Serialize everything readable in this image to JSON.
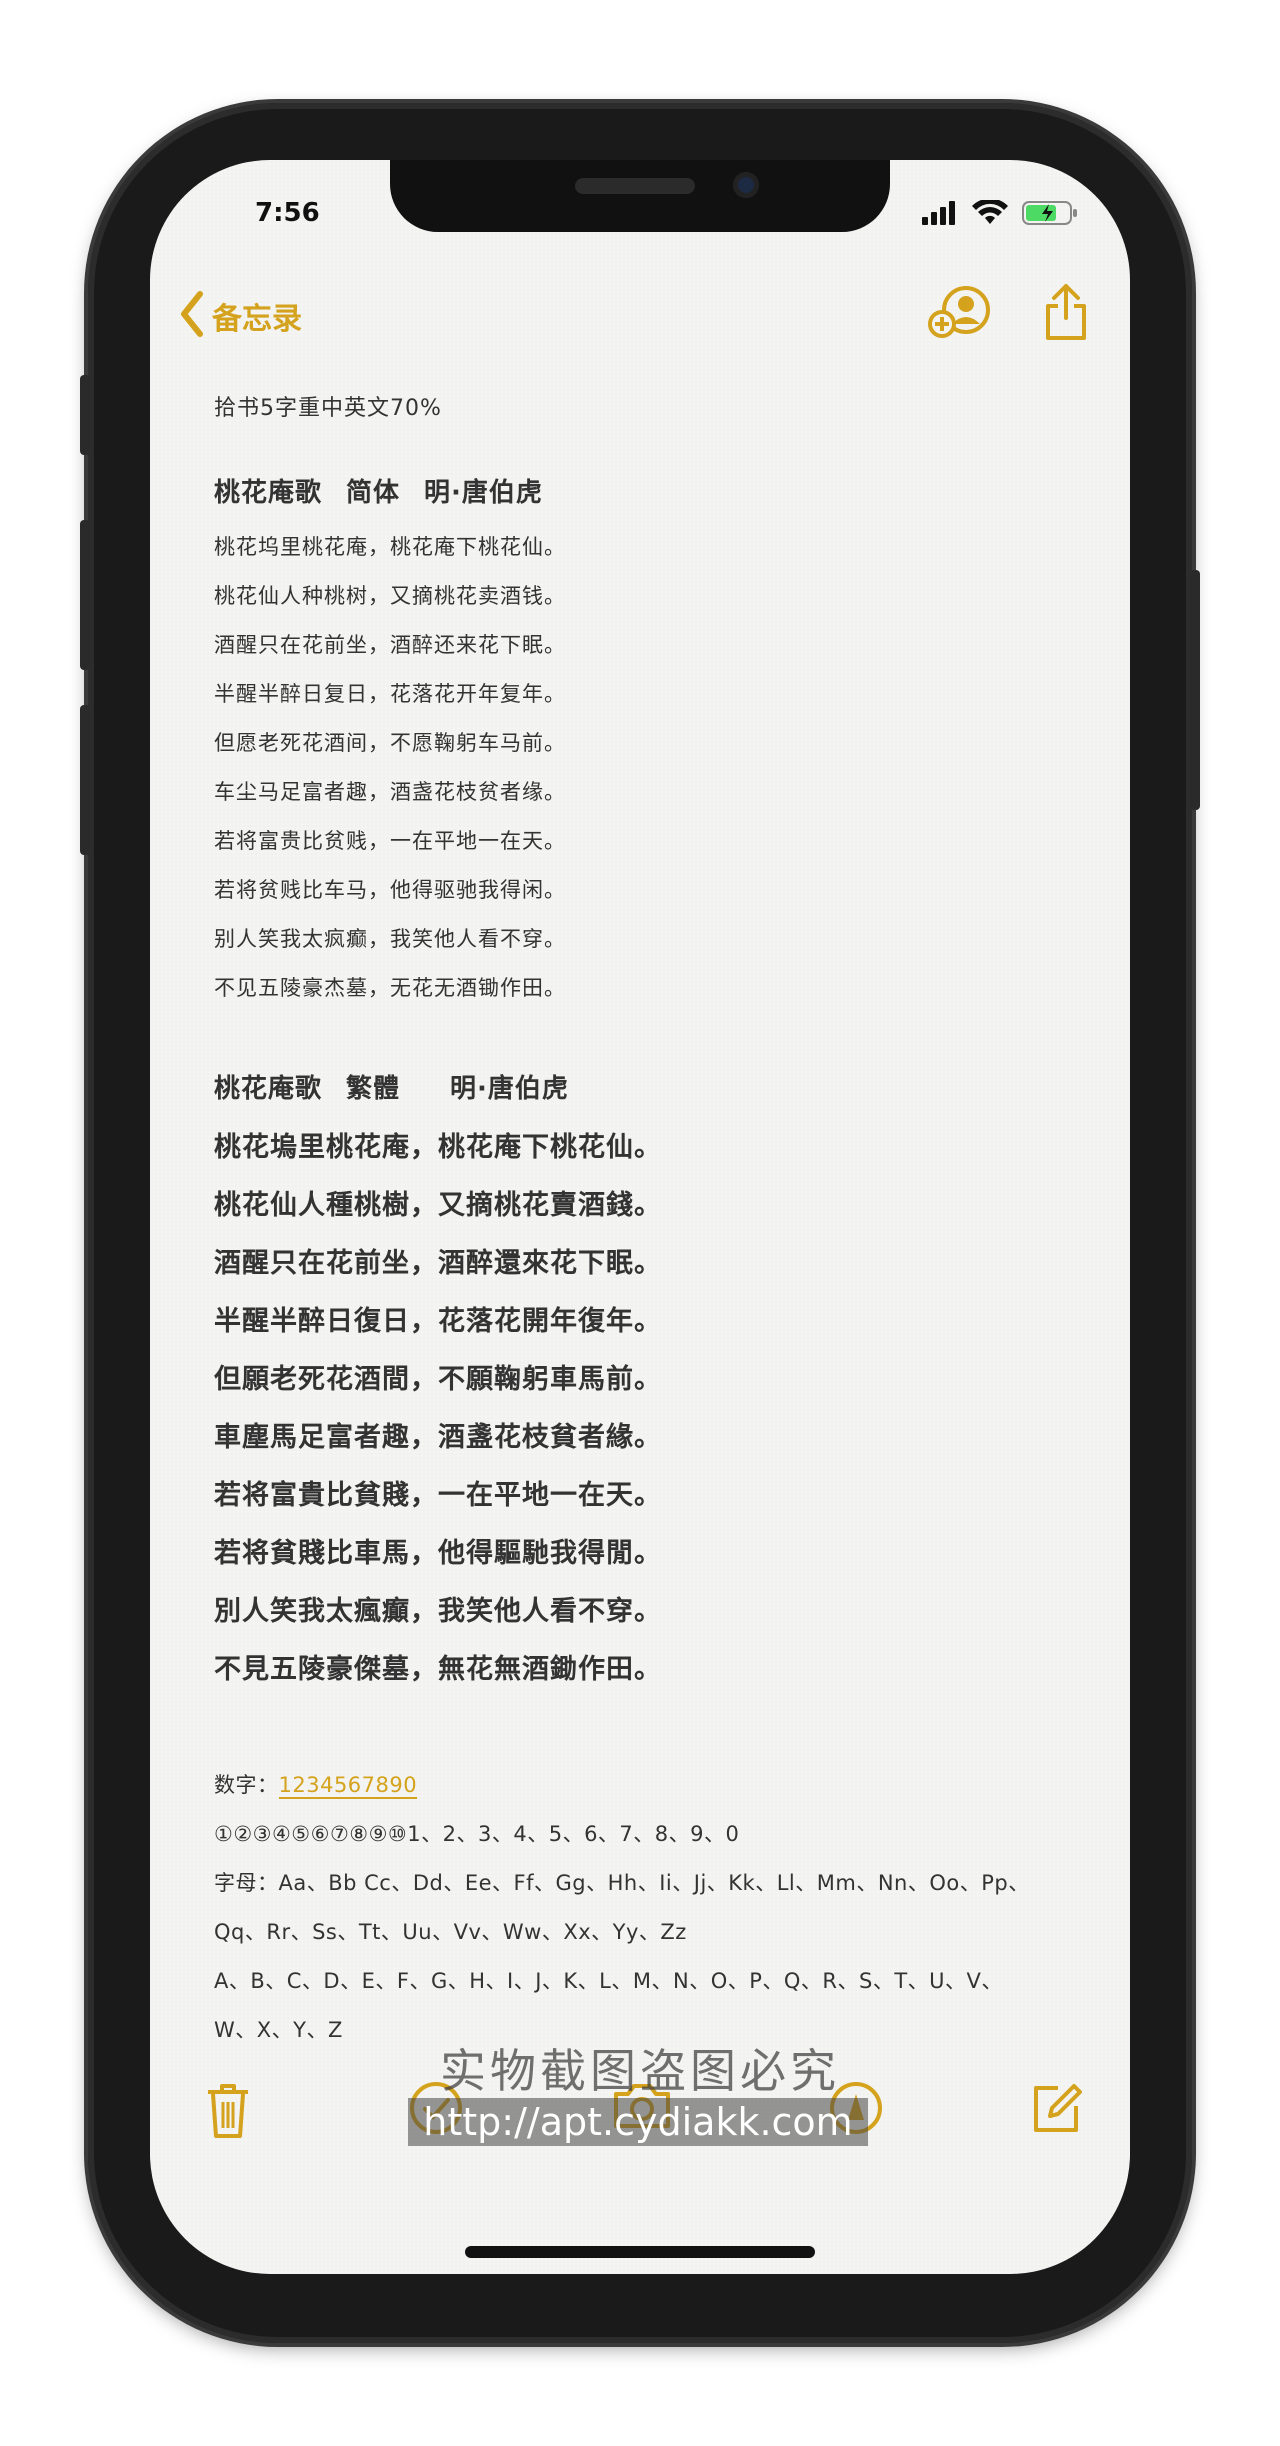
{
  "status": {
    "time": "7:56"
  },
  "nav": {
    "back_label": "备忘录"
  },
  "note": {
    "header": "拾书5字重中英文70%",
    "simplified": {
      "title": "桃花庵歌",
      "tag": "简体",
      "author": "明·唐伯虎",
      "lines": [
        "桃花坞里桃花庵，桃花庵下桃花仙。",
        "桃花仙人种桃树，又摘桃花卖酒钱。",
        "酒醒只在花前坐，酒醉还来花下眠。",
        "半醒半醉日复日，花落花开年复年。",
        "但愿老死花酒间，不愿鞠躬车马前。",
        "车尘马足富者趣，酒盏花枝贫者缘。",
        "若将富贵比贫贱，一在平地一在天。",
        "若将贫贱比车马，他得驱驰我得闲。",
        "别人笑我太疯癫，我笑他人看不穿。",
        "不见五陵豪杰墓，无花无酒锄作田。"
      ]
    },
    "traditional": {
      "title": "桃花庵歌",
      "tag": "繁體",
      "author": "明·唐伯虎",
      "lines": [
        "桃花塢里桃花庵，桃花庵下桃花仙。",
        "桃花仙人種桃樹，又摘桃花賣酒錢。",
        "酒醒只在花前坐，酒醉還來花下眠。",
        "半醒半醉日復日，花落花開年復年。",
        "但願老死花酒間，不願鞠躬車馬前。",
        "車塵馬足富者趣，酒盞花枝貧者緣。",
        "若将富貴比貧賤，一在平地一在天。",
        "若将貧賤比車馬，他得驅馳我得閒。",
        "別人笑我太瘋癲，我笑他人看不穿。",
        "不見五陵豪傑墓，無花無酒鋤作田。"
      ]
    },
    "numbers_label": "数字：",
    "numbers_value": "1234567890",
    "circled_row": "①②③④⑤⑥⑦⑧⑨⑩1、2、3、4、5、6、7、8、9、0",
    "letters_row1": "字母：Aa、Bb Cc、Dd、Ee、Ff、Gg、Hh、Ii、Jj、Kk、Ll、Mm、Nn、Oo、Pp、",
    "letters_row2": "Qq、Rr、Ss、Tt、Uu、Vv、Ww、Xx、Yy、Zz",
    "upper_row1": "A、B、C、D、E、F、G、H、I、J、K、L、M、N、O、P、Q、R、S、T、U、V、",
    "upper_row2": "W、X、Y、Z"
  },
  "watermark": {
    "line1": "实物截图盗图必究",
    "line2": "http://apt.cydiakk.com"
  },
  "colors": {
    "accent": "#d4a21c",
    "background": "#f4f4f2",
    "text": "#333333"
  },
  "icons": [
    "chevron-left-icon",
    "add-person-icon",
    "share-icon",
    "trash-icon",
    "checklist-icon",
    "camera-icon",
    "markup-icon",
    "compose-icon",
    "signal-icon",
    "wifi-icon",
    "battery-icon"
  ]
}
